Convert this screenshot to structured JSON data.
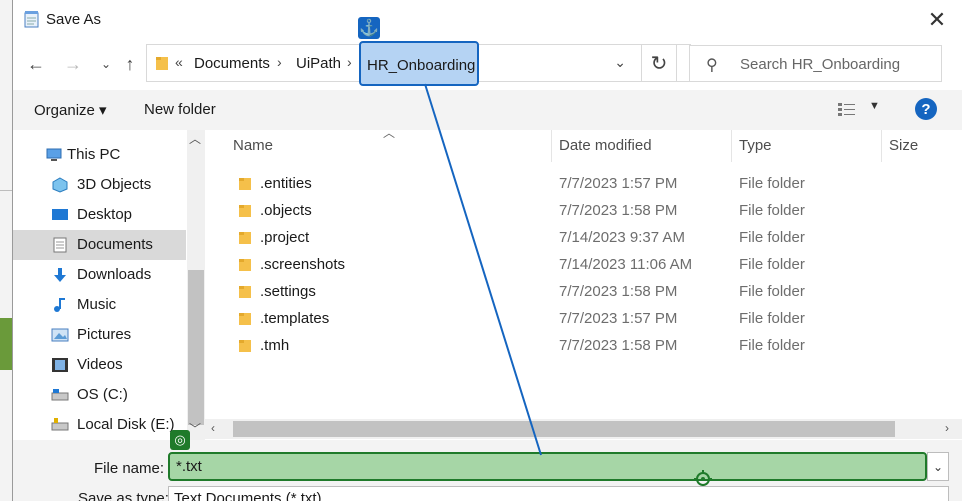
{
  "window": {
    "title": "Save As"
  },
  "address": {
    "overflow": "«",
    "crumbs": [
      "Documents",
      "UiPath",
      "HR_Onboarding"
    ]
  },
  "search": {
    "placeholder": "Search HR_Onboarding"
  },
  "toolbar": {
    "organize_label": "Organize ▾",
    "new_folder_label": "New folder",
    "help_label": "?"
  },
  "nav": {
    "items": [
      {
        "label": "This PC",
        "icon": "pc-icon"
      },
      {
        "label": "3D Objects",
        "icon": "3d-objects-icon"
      },
      {
        "label": "Desktop",
        "icon": "desktop-icon"
      },
      {
        "label": "Documents",
        "icon": "documents-icon",
        "selected": true
      },
      {
        "label": "Downloads",
        "icon": "downloads-icon"
      },
      {
        "label": "Music",
        "icon": "music-icon"
      },
      {
        "label": "Pictures",
        "icon": "pictures-icon"
      },
      {
        "label": "Videos",
        "icon": "videos-icon"
      },
      {
        "label": "OS (C:)",
        "icon": "drive-icon"
      },
      {
        "label": "Local Disk (E:)",
        "icon": "drive-icon"
      }
    ]
  },
  "columns": {
    "name": "Name",
    "date": "Date modified",
    "type": "Type",
    "size": "Size"
  },
  "files": [
    {
      "name": ".entities",
      "date": "7/7/2023 1:57 PM",
      "type": "File folder"
    },
    {
      "name": ".objects",
      "date": "7/7/2023 1:58 PM",
      "type": "File folder"
    },
    {
      "name": ".project",
      "date": "7/14/2023 9:37 AM",
      "type": "File folder"
    },
    {
      "name": ".screenshots",
      "date": "7/14/2023 11:06 AM",
      "type": "File folder"
    },
    {
      "name": ".settings",
      "date": "7/7/2023 1:58 PM",
      "type": "File folder"
    },
    {
      "name": ".templates",
      "date": "7/7/2023 1:57 PM",
      "type": "File folder"
    },
    {
      "name": ".tmh",
      "date": "7/7/2023 1:58 PM",
      "type": "File folder"
    }
  ],
  "filename": {
    "label": "File name:",
    "value": "*.txt"
  },
  "savetype": {
    "label": "Save as type:",
    "value": "Text Documents (*.txt)"
  },
  "colors": {
    "accent_blue": "#1565c0",
    "highlight_blue": "#b5d3f3",
    "target_green": "#1f7a2a",
    "target_fill": "#a6d6a6"
  }
}
